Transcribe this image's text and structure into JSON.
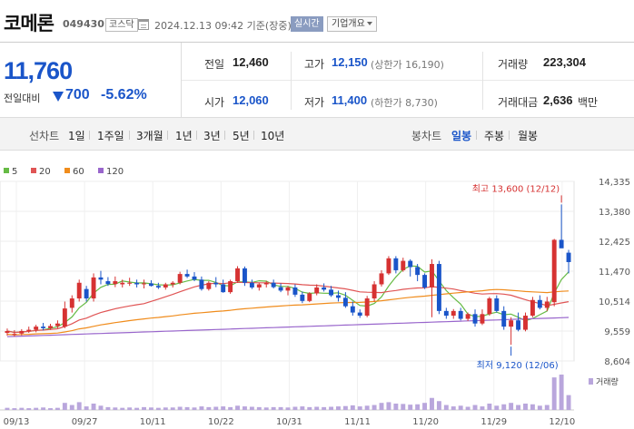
{
  "header": {
    "stock_name": "코메론",
    "stock_code": "049430",
    "market": "코스닥",
    "base_date": "2024.12.13 09:42  기준(장중)",
    "realtime_label": "실시간",
    "company_overview_label": "기업개요"
  },
  "price": {
    "current": "11,760",
    "diff_label": "전일대비",
    "diff_value": "700",
    "diff_rate": "-5.62%",
    "direction": "down",
    "color_down": "#1a55c9",
    "color_up": "#d63232"
  },
  "summary": {
    "prev_close_label": "전일",
    "prev_close": "12,460",
    "high_label": "고가",
    "high": "12,150",
    "upper_limit": "(상한가 16,190)",
    "volume_label": "거래량",
    "volume": "223,304",
    "open_label": "시가",
    "open": "12,060",
    "low_label": "저가",
    "low": "11,400",
    "lower_limit": "(하한가 8,730)",
    "amount_label": "거래대금",
    "amount": "2,636",
    "amount_unit": "백만"
  },
  "tabs": {
    "line_chart_label": "선차트",
    "periods": [
      "1일",
      "1주일",
      "3개월",
      "1년",
      "3년",
      "5년",
      "10년"
    ],
    "candle_label": "봉차트",
    "candle_types": [
      "일봉",
      "주봉",
      "월봉"
    ],
    "active_candle": "일봉"
  },
  "chart_data": {
    "type": "candlestick",
    "legend": [
      {
        "name": "5",
        "color": "#66bb44"
      },
      {
        "name": "20",
        "color": "#e05555"
      },
      {
        "name": "60",
        "color": "#f08c1c"
      },
      {
        "name": "120",
        "color": "#9966cc"
      }
    ],
    "y_ticks": [
      "14,335",
      "13,380",
      "12,425",
      "11,470",
      "10,514",
      "9,559",
      "8,604"
    ],
    "y_range": [
      8604,
      14335
    ],
    "x_ticks": [
      "09/13",
      "09/27",
      "10/11",
      "10/22",
      "10/31",
      "11/11",
      "11/20",
      "11/29",
      "12/10"
    ],
    "high_annotation": "최고 13,600 (12/12)",
    "low_annotation": "최저 9,120 (12/06)",
    "volume_label": "거래량",
    "candles": [
      [
        9500,
        9640,
        9410,
        9560
      ],
      [
        9460,
        9590,
        9380,
        9470
      ],
      [
        9480,
        9620,
        9420,
        9560
      ],
      [
        9560,
        9700,
        9500,
        9600
      ],
      [
        9600,
        9760,
        9520,
        9700
      ],
      [
        9700,
        9820,
        9580,
        9650
      ],
      [
        9650,
        9790,
        9600,
        9720
      ],
      [
        9720,
        9900,
        9650,
        9800
      ],
      [
        9700,
        10500,
        9650,
        10280
      ],
      [
        10300,
        10700,
        10150,
        10600
      ],
      [
        10600,
        11200,
        10500,
        11100
      ],
      [
        10900,
        11000,
        10500,
        10600
      ],
      [
        10600,
        11400,
        10500,
        11270
      ],
      [
        11270,
        11480,
        11050,
        11200
      ],
      [
        11150,
        11280,
        11000,
        11060
      ],
      [
        11060,
        11300,
        10960,
        11150
      ],
      [
        11050,
        11200,
        10950,
        11100
      ],
      [
        11100,
        11260,
        11000,
        11100
      ],
      [
        11100,
        11200,
        10950,
        11050
      ],
      [
        11050,
        11200,
        10920,
        11080
      ],
      [
        11080,
        11180,
        10980,
        11000
      ],
      [
        11000,
        11100,
        10900,
        10950
      ],
      [
        10950,
        11100,
        10880,
        11050
      ],
      [
        11050,
        11150,
        10950,
        11100
      ],
      [
        11100,
        11450,
        11050,
        11380
      ],
      [
        11380,
        11520,
        11250,
        11300
      ],
      [
        11300,
        11440,
        11150,
        11200
      ],
      [
        11200,
        11300,
        10850,
        10900
      ],
      [
        10900,
        11150,
        10850,
        11100
      ],
      [
        11100,
        11280,
        10960,
        11050
      ],
      [
        11050,
        11200,
        10780,
        10800
      ],
      [
        10800,
        11200,
        10750,
        11150
      ],
      [
        11150,
        11630,
        11100,
        11560
      ],
      [
        11560,
        11620,
        11000,
        11100
      ],
      [
        11100,
        11200,
        10900,
        10950
      ],
      [
        10950,
        11100,
        10850,
        11050
      ],
      [
        11050,
        11160,
        10950,
        11100
      ],
      [
        11100,
        11200,
        10920,
        10960
      ],
      [
        10960,
        11080,
        10800,
        10850
      ],
      [
        10850,
        11000,
        10700,
        10950
      ],
      [
        10950,
        11050,
        10650,
        10720
      ],
      [
        10720,
        10820,
        10450,
        10520
      ],
      [
        10520,
        10800,
        10480,
        10760
      ],
      [
        10760,
        11050,
        10700,
        10950
      ],
      [
        10950,
        11080,
        10820,
        10880
      ],
      [
        10880,
        11000,
        10650,
        10700
      ],
      [
        10700,
        10850,
        10500,
        10620
      ],
      [
        10620,
        10800,
        10300,
        10350
      ],
      [
        10350,
        10500,
        10050,
        10150
      ],
      [
        10150,
        10250,
        9980,
        10050
      ],
      [
        10050,
        10680,
        10000,
        10600
      ],
      [
        10600,
        11150,
        10500,
        11050
      ],
      [
        11050,
        11500,
        10980,
        11400
      ],
      [
        11400,
        11950,
        11350,
        11880
      ],
      [
        11880,
        11950,
        11400,
        11500
      ],
      [
        11500,
        11900,
        11450,
        11800
      ],
      [
        11800,
        11850,
        11300,
        11600
      ],
      [
        11600,
        11700,
        11150,
        11350
      ],
      [
        11350,
        11400,
        10900,
        10950
      ],
      [
        10950,
        11850,
        10000,
        11700
      ],
      [
        11700,
        11800,
        10100,
        10200
      ],
      [
        10200,
        10300,
        9950,
        10050
      ],
      [
        10050,
        10260,
        9950,
        10200
      ],
      [
        10200,
        10300,
        9900,
        9950
      ],
      [
        9950,
        10150,
        9880,
        10100
      ],
      [
        10100,
        10250,
        9700,
        9800
      ],
      [
        9800,
        10250,
        9750,
        10100
      ],
      [
        10100,
        10650,
        10050,
        10600
      ],
      [
        10600,
        10700,
        10150,
        10200
      ],
      [
        10200,
        10350,
        9600,
        9700
      ],
      [
        9700,
        10000,
        9120,
        9900
      ],
      [
        9900,
        10150,
        9550,
        9600
      ],
      [
        9600,
        10150,
        9550,
        10050
      ],
      [
        10050,
        10650,
        10000,
        10550
      ],
      [
        10550,
        10700,
        10250,
        10300
      ],
      [
        10300,
        10650,
        10200,
        10500
      ],
      [
        10480,
        12500,
        10350,
        12470
      ],
      [
        12470,
        13600,
        12300,
        12200
      ],
      [
        12060,
        12150,
        11400,
        11760
      ]
    ],
    "volumes": [
      6,
      5,
      6,
      5,
      6,
      7,
      5,
      6,
      20,
      14,
      22,
      10,
      18,
      12,
      8,
      7,
      6,
      7,
      6,
      8,
      7,
      6,
      7,
      7,
      9,
      8,
      7,
      10,
      8,
      9,
      10,
      8,
      12,
      10,
      9,
      8,
      7,
      8,
      8,
      7,
      9,
      10,
      8,
      9,
      8,
      9,
      10,
      11,
      13,
      10,
      12,
      14,
      20,
      22,
      18,
      17,
      15,
      16,
      20,
      34,
      25,
      14,
      10,
      12,
      9,
      14,
      10,
      18,
      12,
      16,
      20,
      14,
      18,
      16,
      12,
      14,
      92,
      100,
      42
    ]
  }
}
